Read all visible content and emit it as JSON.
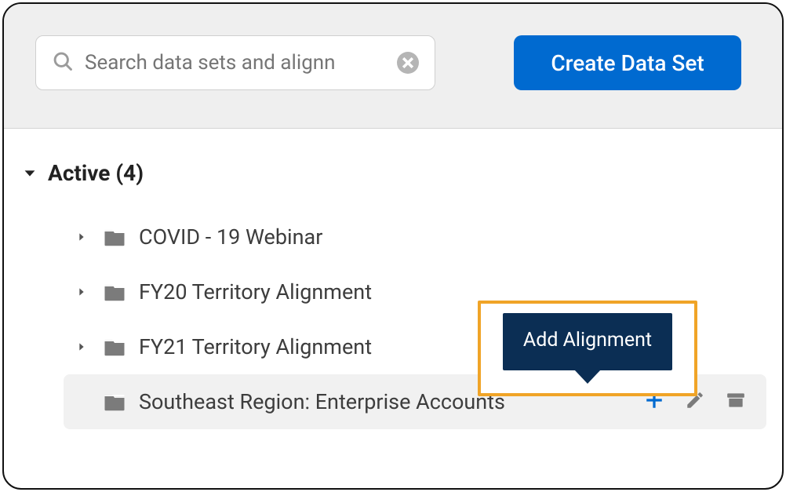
{
  "toolbar": {
    "search_placeholder": "Search data sets and alignn",
    "create_label": "Create Data Set"
  },
  "section": {
    "title": "Active (4)"
  },
  "items": [
    {
      "label": "COVID - 19 Webinar",
      "expandable": true,
      "selected": false
    },
    {
      "label": "FY20 Territory Alignment",
      "expandable": true,
      "selected": false
    },
    {
      "label": "FY21 Territory Alignment",
      "expandable": true,
      "selected": false
    },
    {
      "label": "Southeast Region: Enterprise Accounts",
      "expandable": false,
      "selected": true
    }
  ],
  "tooltip": {
    "label": "Add Alignment"
  }
}
